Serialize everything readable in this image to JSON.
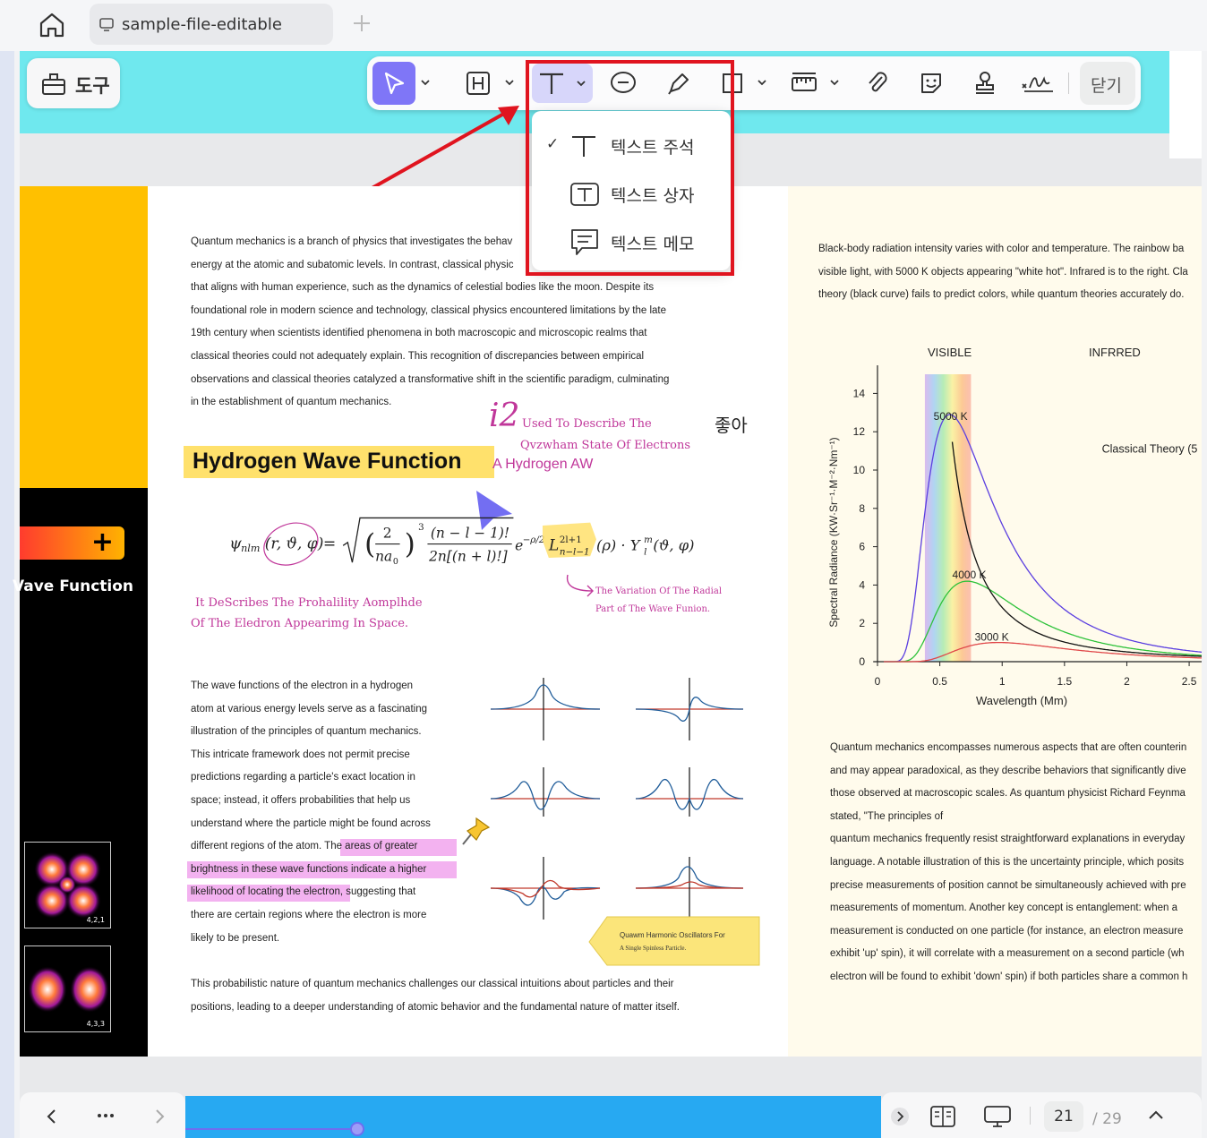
{
  "tabbar": {
    "tab_title": "sample-file-editable"
  },
  "toolbar": {
    "tools_label": "도구",
    "close_label": "닫기"
  },
  "text_menu": {
    "items": [
      {
        "label": "텍스트 주석",
        "checked": true
      },
      {
        "label": "텍스트 상자",
        "checked": false
      },
      {
        "label": "텍스트 메모",
        "checked": false
      }
    ]
  },
  "left_panel": {
    "wave_function_title": "Vave Function",
    "plus": "+",
    "thumb1_label": "4,2,1",
    "thumb2_label": "4,3,3"
  },
  "main_page": {
    "intro_lines": [
      "Quantum mechanics is a branch of physics that investigates the behav",
      "energy at the atomic and subatomic levels. In contrast, classical physic",
      "that aligns with human experience, such as the dynamics of celestial bodies like the moon. Despite its",
      "foundational role in modern science and technology, classical physics encountered limitations by the late",
      "19th century when scientists identified phenomena in both macroscopic and microscopic realms that",
      "classical theories could not adequately explain. This recognition of discrepancies between empirical",
      "observations and classical theories catalyzed a transformative shift in the scientific paradigm, culminating",
      "in the establishment of quantum mechanics."
    ],
    "heading": "Hydrogen Wave Function",
    "annot_i2": "i2",
    "annot_i2_line1": "Used To Describe The",
    "annot_i2_line2": "Qvzwham State Of Electrons",
    "annot_hydrogen": "A Hydrogen AW",
    "annot_korean": "좋아",
    "annot_left_line1": "It DeScribes The Prohalility Aomplhde",
    "annot_left_line2": "Of The Eledron Appearimg In Space.",
    "annot_right_line1": "The Variation Of The Radial",
    "annot_right_line2": "Part of The Wave Funion.",
    "body_lines": [
      "The wave functions of the electron in a hydrogen",
      "atom at various energy levels serve as a fascinating",
      "illustration of the principles of quantum mechanics.",
      "This intricate framework does not permit precise",
      "predictions regarding a particle's exact location in",
      "space; instead, it offers probabilities that help us",
      "understand where the particle might be found across",
      "different regions of the atom. The areas of greater",
      "brightness in these wave functions indicate a higher",
      "likelihood of locating the electron, suggesting that",
      "there are certain regions where the electron is more",
      "likely to be present."
    ],
    "note_line1": "Quawm Harmonic Oscillators For",
    "note_line2": "A Single Spinless Particle.",
    "closing_lines": [
      "This probabilistic nature of quantum mechanics challenges our classical intuitions about particles and their",
      "positions, leading to a deeper understanding of atomic behavior and the fundamental nature of matter itself."
    ]
  },
  "right_page": {
    "intro_lines": [
      "Black-body radiation intensity varies with color and temperature. The rainbow ba",
      "visible light, with 5000 K objects appearing \"white hot\". Infrared is to the right. Cla",
      "theory (black curve) fails to predict colors, while quantum theories accurately do."
    ],
    "body_lines": [
      "Quantum mechanics encompasses numerous aspects that are often counterin",
      "and may appear paradoxical, as they describe behaviors that significantly dive",
      "those observed at macroscopic scales. As quantum physicist Richard Feynma",
      "stated, \"The principles of",
      "quantum mechanics frequently resist straightforward explanations in everyday",
      "language. A notable illustration of this is the uncertainty principle, which posits",
      "precise measurements of position cannot be simultaneously achieved with pre",
      "measurements of momentum. Another key concept is entanglement: when a",
      "measurement is conducted on one particle (for instance, an electron measure",
      "exhibit 'up' spin), it will correlate with a measurement on a second particle (wh",
      "electron will be found to exhibit 'down' spin) if both particles share a common h"
    ]
  },
  "chart_data": {
    "type": "line",
    "title": "",
    "xlabel": "Wavelength (Mm)",
    "ylabel": "Spectral Radiance (KW·Sr⁻¹·M⁻²·Nm⁻¹)",
    "xlim": [
      0,
      2.6
    ],
    "ylim": [
      0,
      15
    ],
    "x_ticks": [
      "0",
      "0.5",
      "1",
      "1.5",
      "2",
      "2.5"
    ],
    "y_ticks": [
      "0",
      "2",
      "4",
      "6",
      "8",
      "10",
      "12",
      "14"
    ],
    "region_labels": [
      "VISIBLE",
      "INFRRED"
    ],
    "series": [
      {
        "name": "5000 K",
        "color": "#5b3fe0",
        "peak_x": 0.58,
        "peak_y": 12.9
      },
      {
        "name": "4000 K",
        "color": "#2ec23a",
        "peak_x": 0.72,
        "peak_y": 4.2
      },
      {
        "name": "3000 K",
        "color": "#e0484a",
        "peak_x": 0.97,
        "peak_y": 1.0
      },
      {
        "name": "Classical Theory (5",
        "color": "#111111"
      }
    ]
  },
  "bottom_bar": {
    "page_current": "21",
    "page_total": "/ 29"
  }
}
